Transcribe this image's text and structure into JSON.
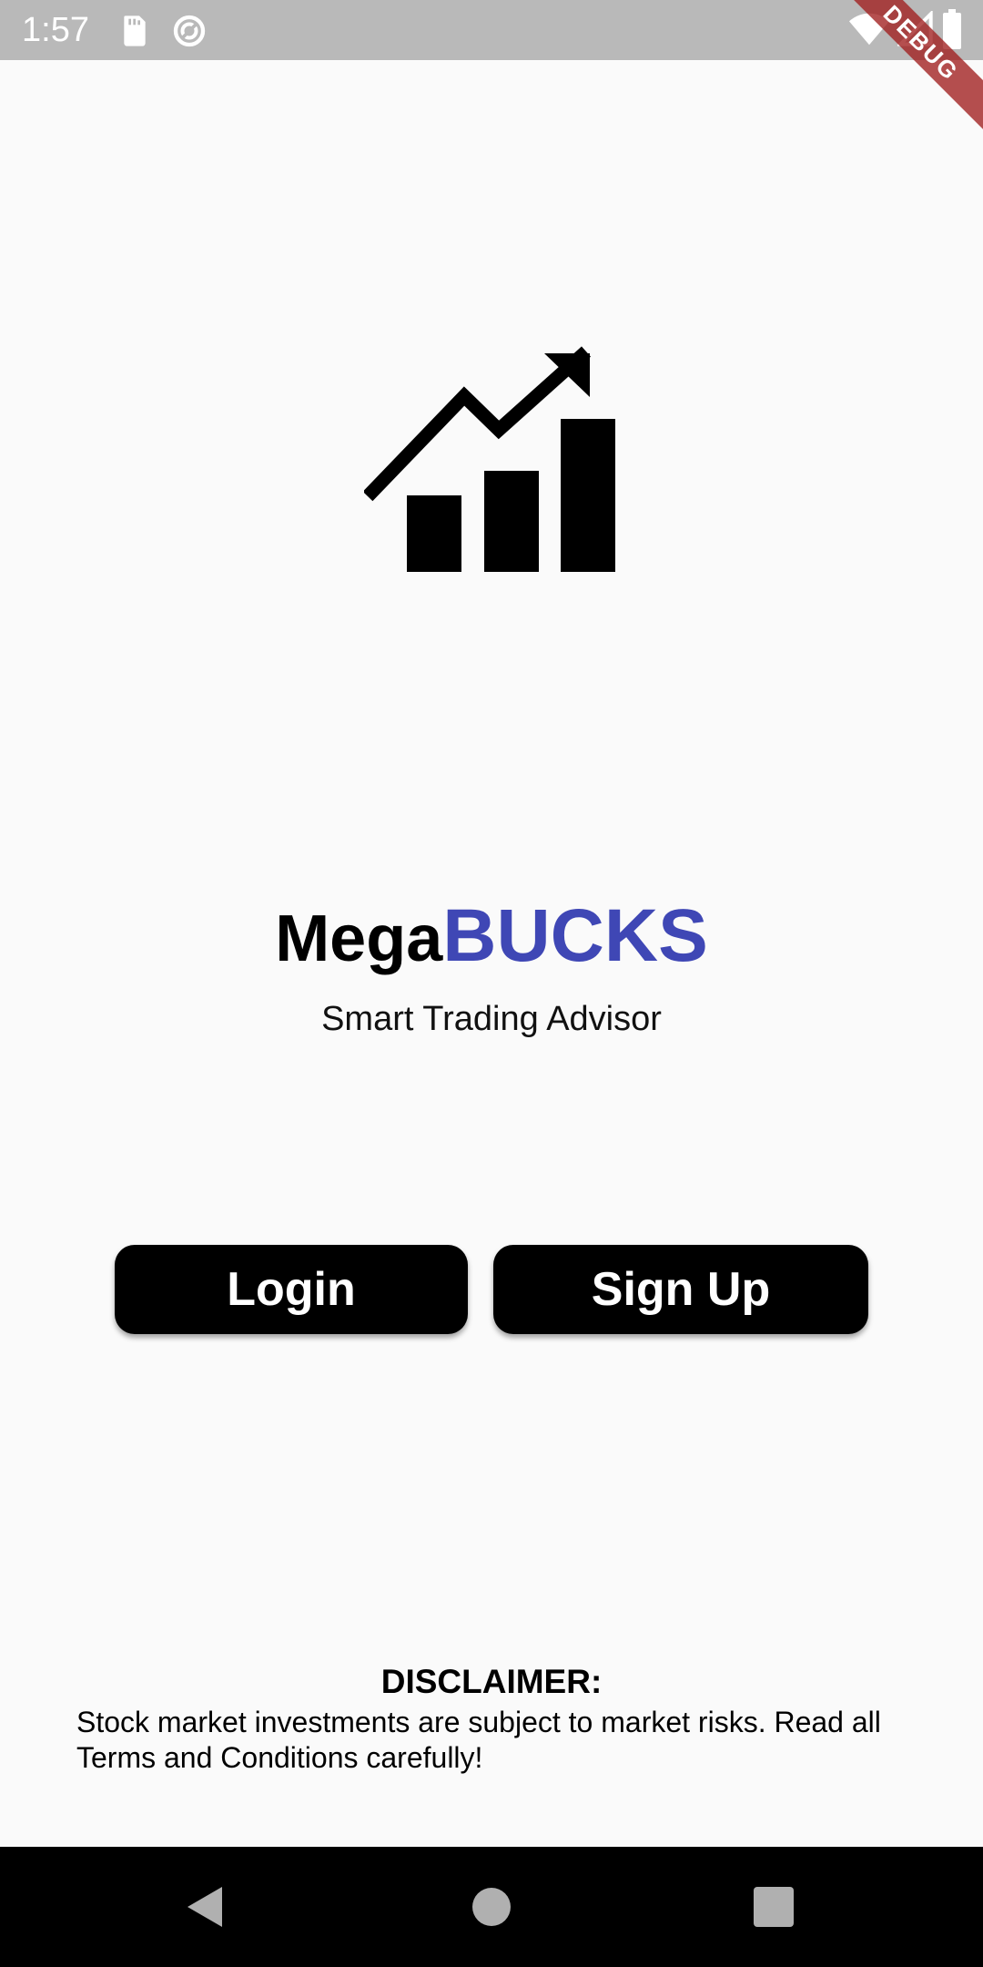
{
  "status_bar": {
    "time": "1:57",
    "icons": [
      "sd-card-icon",
      "sync-icon",
      "wifi-icon",
      "cell-signal-icon",
      "battery-icon"
    ],
    "debug_banner": "DEBUG"
  },
  "logo": {
    "icon": "growth-chart-icon"
  },
  "title": {
    "part1": "Mega",
    "part2": "BUCKS"
  },
  "subtitle": "Smart Trading Advisor",
  "buttons": {
    "login": "Login",
    "signup": "Sign Up"
  },
  "disclaimer": {
    "title": "DISCLAIMER:",
    "text": "Stock market investments are subject to market risks. Read all Terms and Conditions carefully!"
  },
  "nav_bar": {
    "icons": [
      "back-icon",
      "home-icon",
      "recents-icon"
    ]
  },
  "colors": {
    "accent": "#3f47b5",
    "background": "#fafafa",
    "button": "#000000",
    "status_bar": "#b9b9b9",
    "debug_ribbon": "#a01e1e"
  }
}
